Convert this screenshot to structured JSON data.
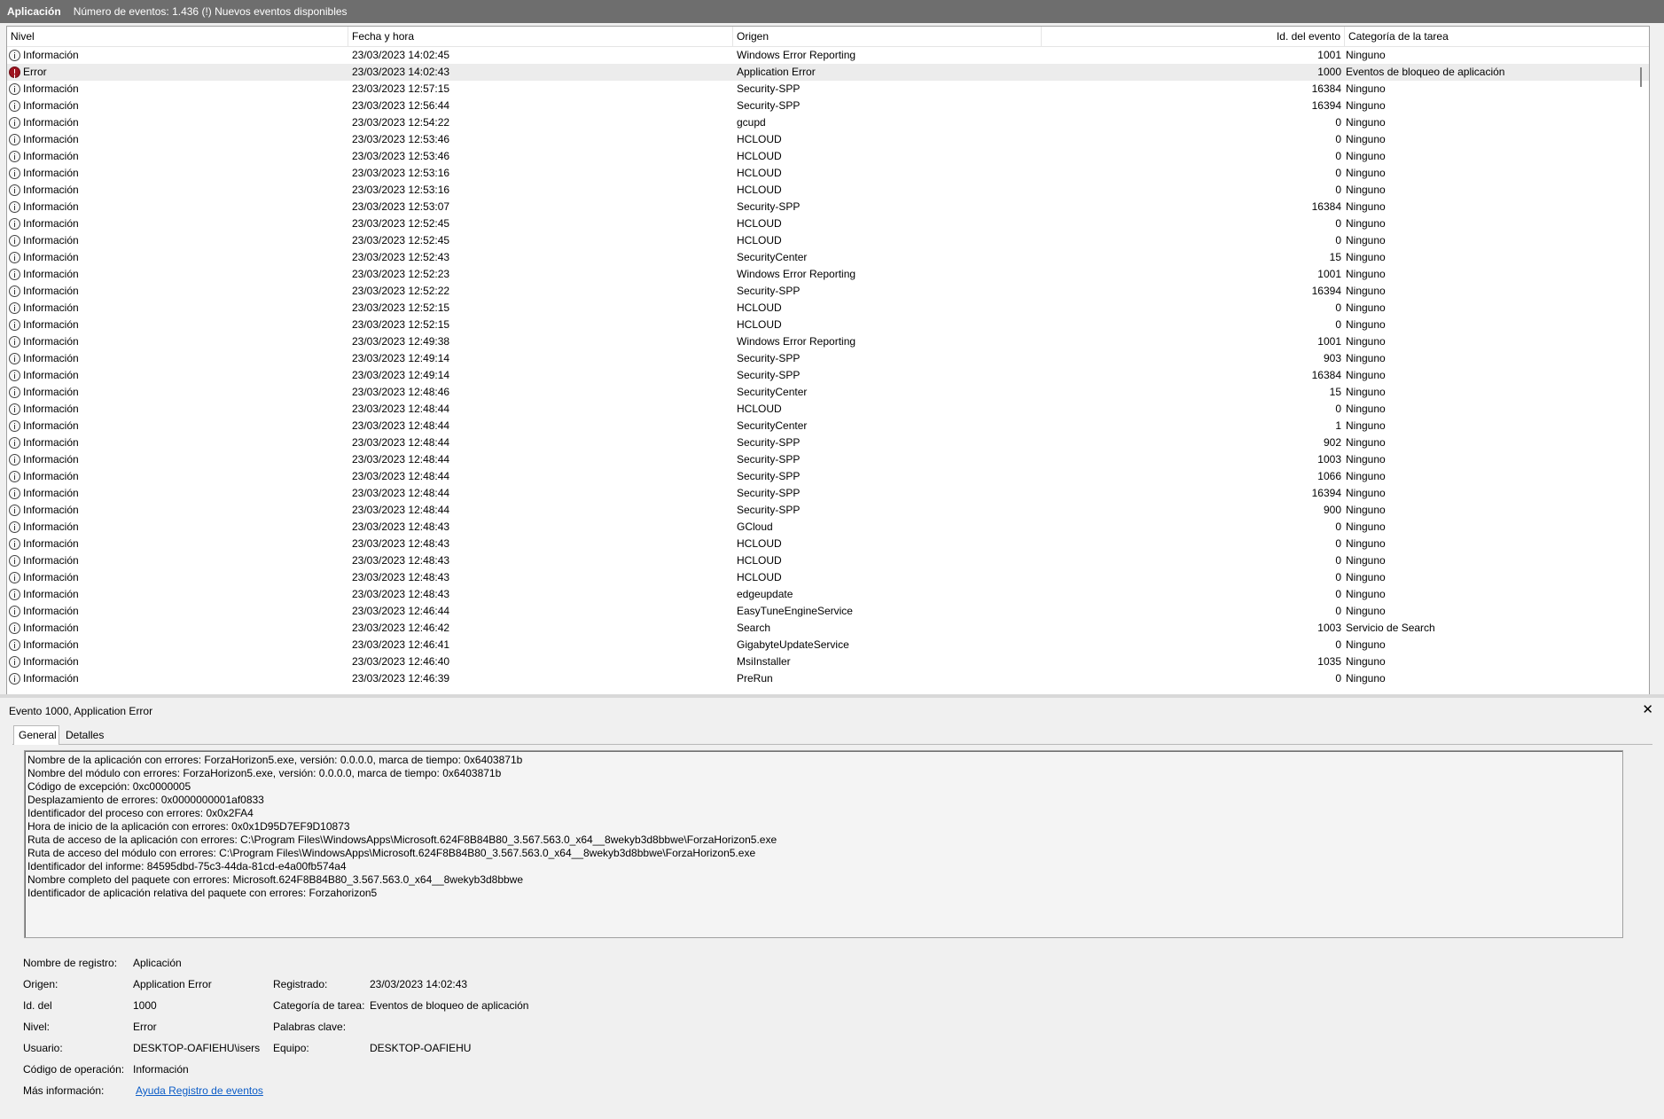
{
  "titlebar": {
    "app": "Aplicación",
    "status": "Número de eventos: 1.436 (!) Nuevos eventos disponibles"
  },
  "columns": {
    "level": "Nivel",
    "date": "Fecha y hora",
    "source": "Origen",
    "id": "Id. del evento",
    "category": "Categoría de la tarea"
  },
  "icons": {
    "info": "information-icon",
    "error": "error-icon",
    "close": "close-icon"
  },
  "colors": {
    "error_icon": "#9e1420",
    "link": "#0b5cc7",
    "titlebar": "#6e6e6e"
  },
  "events": [
    {
      "level": "Información",
      "type": "info",
      "date": "23/03/2023 14:02:45",
      "source": "Windows Error Reporting",
      "id": "1001",
      "category": "Ninguno"
    },
    {
      "level": "Error",
      "type": "error",
      "date": "23/03/2023 14:02:43",
      "source": "Application Error",
      "id": "1000",
      "category": "Eventos de bloqueo de aplicación",
      "selected": true
    },
    {
      "level": "Información",
      "type": "info",
      "date": "23/03/2023 12:57:15",
      "source": "Security-SPP",
      "id": "16384",
      "category": "Ninguno"
    },
    {
      "level": "Información",
      "type": "info",
      "date": "23/03/2023 12:56:44",
      "source": "Security-SPP",
      "id": "16394",
      "category": "Ninguno"
    },
    {
      "level": "Información",
      "type": "info",
      "date": "23/03/2023 12:54:22",
      "source": "gcupd",
      "id": "0",
      "category": "Ninguno"
    },
    {
      "level": "Información",
      "type": "info",
      "date": "23/03/2023 12:53:46",
      "source": "HCLOUD",
      "id": "0",
      "category": "Ninguno"
    },
    {
      "level": "Información",
      "type": "info",
      "date": "23/03/2023 12:53:46",
      "source": "HCLOUD",
      "id": "0",
      "category": "Ninguno"
    },
    {
      "level": "Información",
      "type": "info",
      "date": "23/03/2023 12:53:16",
      "source": "HCLOUD",
      "id": "0",
      "category": "Ninguno"
    },
    {
      "level": "Información",
      "type": "info",
      "date": "23/03/2023 12:53:16",
      "source": "HCLOUD",
      "id": "0",
      "category": "Ninguno"
    },
    {
      "level": "Información",
      "type": "info",
      "date": "23/03/2023 12:53:07",
      "source": "Security-SPP",
      "id": "16384",
      "category": "Ninguno"
    },
    {
      "level": "Información",
      "type": "info",
      "date": "23/03/2023 12:52:45",
      "source": "HCLOUD",
      "id": "0",
      "category": "Ninguno"
    },
    {
      "level": "Información",
      "type": "info",
      "date": "23/03/2023 12:52:45",
      "source": "HCLOUD",
      "id": "0",
      "category": "Ninguno"
    },
    {
      "level": "Información",
      "type": "info",
      "date": "23/03/2023 12:52:43",
      "source": "SecurityCenter",
      "id": "15",
      "category": "Ninguno"
    },
    {
      "level": "Información",
      "type": "info",
      "date": "23/03/2023 12:52:23",
      "source": "Windows Error Reporting",
      "id": "1001",
      "category": "Ninguno"
    },
    {
      "level": "Información",
      "type": "info",
      "date": "23/03/2023 12:52:22",
      "source": "Security-SPP",
      "id": "16394",
      "category": "Ninguno"
    },
    {
      "level": "Información",
      "type": "info",
      "date": "23/03/2023 12:52:15",
      "source": "HCLOUD",
      "id": "0",
      "category": "Ninguno"
    },
    {
      "level": "Información",
      "type": "info",
      "date": "23/03/2023 12:52:15",
      "source": "HCLOUD",
      "id": "0",
      "category": "Ninguno"
    },
    {
      "level": "Información",
      "type": "info",
      "date": "23/03/2023 12:49:38",
      "source": "Windows Error Reporting",
      "id": "1001",
      "category": "Ninguno"
    },
    {
      "level": "Información",
      "type": "info",
      "date": "23/03/2023 12:49:14",
      "source": "Security-SPP",
      "id": "903",
      "category": "Ninguno"
    },
    {
      "level": "Información",
      "type": "info",
      "date": "23/03/2023 12:49:14",
      "source": "Security-SPP",
      "id": "16384",
      "category": "Ninguno"
    },
    {
      "level": "Información",
      "type": "info",
      "date": "23/03/2023 12:48:46",
      "source": "SecurityCenter",
      "id": "15",
      "category": "Ninguno"
    },
    {
      "level": "Información",
      "type": "info",
      "date": "23/03/2023 12:48:44",
      "source": "HCLOUD",
      "id": "0",
      "category": "Ninguno"
    },
    {
      "level": "Información",
      "type": "info",
      "date": "23/03/2023 12:48:44",
      "source": "SecurityCenter",
      "id": "1",
      "category": "Ninguno"
    },
    {
      "level": "Información",
      "type": "info",
      "date": "23/03/2023 12:48:44",
      "source": "Security-SPP",
      "id": "902",
      "category": "Ninguno"
    },
    {
      "level": "Información",
      "type": "info",
      "date": "23/03/2023 12:48:44",
      "source": "Security-SPP",
      "id": "1003",
      "category": "Ninguno"
    },
    {
      "level": "Información",
      "type": "info",
      "date": "23/03/2023 12:48:44",
      "source": "Security-SPP",
      "id": "1066",
      "category": "Ninguno"
    },
    {
      "level": "Información",
      "type": "info",
      "date": "23/03/2023 12:48:44",
      "source": "Security-SPP",
      "id": "16394",
      "category": "Ninguno"
    },
    {
      "level": "Información",
      "type": "info",
      "date": "23/03/2023 12:48:44",
      "source": "Security-SPP",
      "id": "900",
      "category": "Ninguno"
    },
    {
      "level": "Información",
      "type": "info",
      "date": "23/03/2023 12:48:43",
      "source": "GCloud",
      "id": "0",
      "category": "Ninguno"
    },
    {
      "level": "Información",
      "type": "info",
      "date": "23/03/2023 12:48:43",
      "source": "HCLOUD",
      "id": "0",
      "category": "Ninguno"
    },
    {
      "level": "Información",
      "type": "info",
      "date": "23/03/2023 12:48:43",
      "source": "HCLOUD",
      "id": "0",
      "category": "Ninguno"
    },
    {
      "level": "Información",
      "type": "info",
      "date": "23/03/2023 12:48:43",
      "source": "HCLOUD",
      "id": "0",
      "category": "Ninguno"
    },
    {
      "level": "Información",
      "type": "info",
      "date": "23/03/2023 12:48:43",
      "source": "edgeupdate",
      "id": "0",
      "category": "Ninguno"
    },
    {
      "level": "Información",
      "type": "info",
      "date": "23/03/2023 12:46:44",
      "source": "EasyTuneEngineService",
      "id": "0",
      "category": "Ninguno"
    },
    {
      "level": "Información",
      "type": "info",
      "date": "23/03/2023 12:46:42",
      "source": "Search",
      "id": "1003",
      "category": "Servicio de Search"
    },
    {
      "level": "Información",
      "type": "info",
      "date": "23/03/2023 12:46:41",
      "source": "GigabyteUpdateService",
      "id": "0",
      "category": "Ninguno"
    },
    {
      "level": "Información",
      "type": "info",
      "date": "23/03/2023 12:46:40",
      "source": "MsiInstaller",
      "id": "1035",
      "category": "Ninguno"
    },
    {
      "level": "Información",
      "type": "info",
      "date": "23/03/2023 12:46:39",
      "source": "PreRun",
      "id": "0",
      "category": "Ninguno"
    }
  ],
  "detail": {
    "title": "Evento 1000, Application Error",
    "tabs": {
      "general": "General",
      "details": "Detalles"
    },
    "description": [
      "Nombre de la aplicación con errores: ForzaHorizon5.exe, versión: 0.0.0.0, marca de tiempo: 0x6403871b",
      "Nombre del módulo con errores: ForzaHorizon5.exe, versión: 0.0.0.0, marca de tiempo: 0x6403871b",
      "Código de excepción: 0xc0000005",
      "Desplazamiento de errores: 0x0000000001af0833",
      "Identificador del proceso con errores: 0x0x2FA4",
      "Hora de inicio de la aplicación con errores: 0x0x1D95D7EF9D10873",
      "Ruta de acceso de la aplicación con errores: C:\\Program Files\\WindowsApps\\Microsoft.624F8B84B80_3.567.563.0_x64__8wekyb3d8bbwe\\ForzaHorizon5.exe",
      "Ruta de acceso del módulo con errores: C:\\Program Files\\WindowsApps\\Microsoft.624F8B84B80_3.567.563.0_x64__8wekyb3d8bbwe\\ForzaHorizon5.exe",
      "Identificador del informe: 84595dbd-75c3-44da-81cd-e4a00fb574a4",
      "Nombre completo del paquete con errores: Microsoft.624F8B84B80_3.567.563.0_x64__8wekyb3d8bbwe",
      "Identificador de aplicación relativa del paquete con errores: Forzahorizon5"
    ],
    "props": {
      "log_name_label": "Nombre de registro:",
      "log_name": "Aplicación",
      "source_label": "Origen:",
      "source": "Application Error",
      "logged_label": "Registrado:",
      "logged": "23/03/2023 14:02:43",
      "id_label": "Id. del",
      "id": "1000",
      "category_label": "Categoría de tarea:",
      "category": "Eventos de bloqueo de aplicación",
      "level_label": "Nivel:",
      "level": "Error",
      "keywords_label": "Palabras clave:",
      "user_label": "Usuario:",
      "user": "DESKTOP-OAFIEHU\\isers",
      "computer_label": "Equipo:",
      "computer": "DESKTOP-OAFIEHU",
      "opcode_label": "Código de operación:",
      "opcode": "Información",
      "more_info_label": "Más información:",
      "more_info_link": "Ayuda Registro de eventos"
    }
  }
}
